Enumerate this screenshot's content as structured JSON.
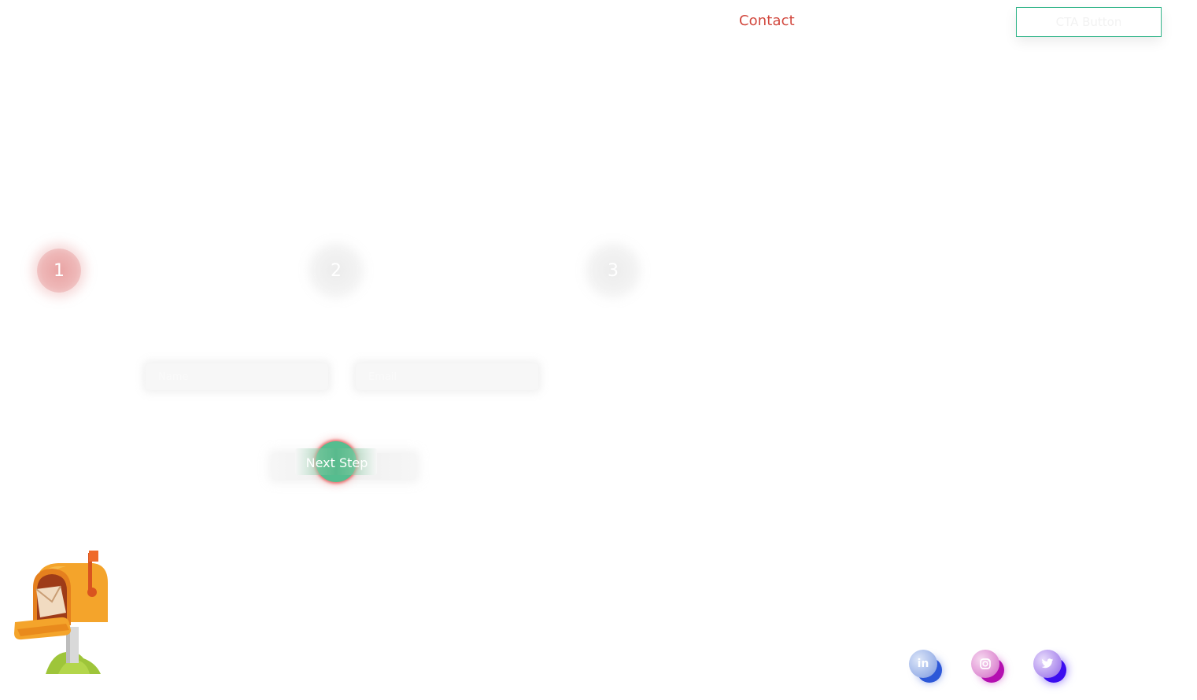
{
  "header": {
    "nav_contact": "Contact",
    "cta_label": "CTA Button"
  },
  "steps": [
    {
      "label": "1",
      "state": "active"
    },
    {
      "label": "2",
      "state": "inactive"
    },
    {
      "label": "3",
      "state": "inactive"
    }
  ],
  "form": {
    "name_placeholder": "Name",
    "email_placeholder": "Email",
    "next_label": "Next Step"
  },
  "social": {
    "linkedin": {
      "icon": "linkedin-icon",
      "glyph": "in"
    },
    "instagram": {
      "icon": "instagram-icon"
    },
    "twitter": {
      "icon": "twitter-icon"
    }
  },
  "colors": {
    "contact": "#d2483e",
    "cta_border": "#33b58a",
    "next_button": "#55bd8f",
    "step_active": "#e9a3a3",
    "linkedin": "#2d58d8",
    "instagram": "#b40fb0",
    "twitter": "#3b0df0"
  }
}
